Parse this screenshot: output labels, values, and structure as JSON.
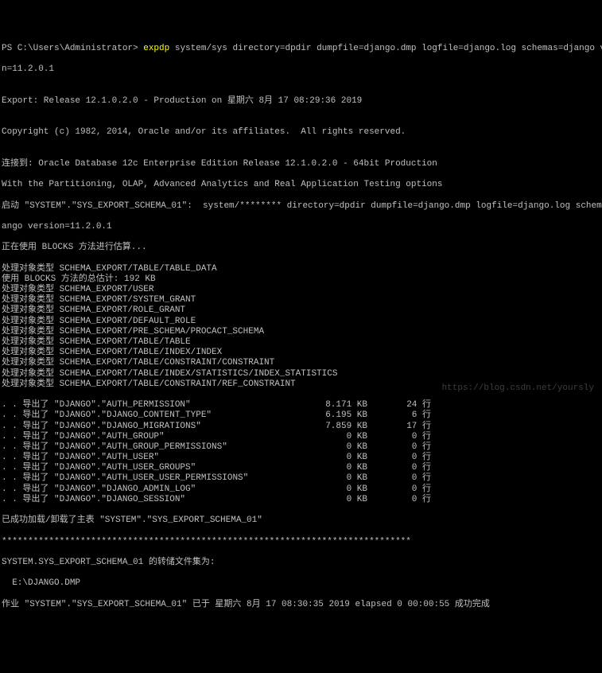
{
  "prompt": {
    "prefix": "PS C:\\Users\\Administrator> ",
    "command": "expdp",
    "args": " system/sys directory=dpdir dumpfile=django.dmp logfile=django.log schemas=django versio",
    "args_line2": "n=11.2.0.1"
  },
  "blank1": "",
  "export_line": "Export: Release 12.1.0.2.0 - Production on 星期六 8月 17 08:29:36 2019",
  "blank2": "",
  "copyright": "Copyright (c) 1982, 2014, Oracle and/or its affiliates.  All rights reserved.",
  "blank3": "",
  "connected": "连接到: Oracle Database 12c Enterprise Edition Release 12.1.0.2.0 - 64bit Production",
  "with_line": "With the Partitioning, OLAP, Advanced Analytics and Real Application Testing options",
  "start_line1": "启动 \"SYSTEM\".\"SYS_EXPORT_SCHEMA_01\":  system/******** directory=dpdir dumpfile=django.dmp logfile=django.log schemas=dj",
  "start_line2": "ango version=11.2.0.1",
  "using_blocks": "正在使用 BLOCKS 方法进行估算...",
  "types": [
    "处理对象类型 SCHEMA_EXPORT/TABLE/TABLE_DATA",
    "使用 BLOCKS 方法的总估计: 192 KB",
    "处理对象类型 SCHEMA_EXPORT/USER",
    "处理对象类型 SCHEMA_EXPORT/SYSTEM_GRANT",
    "处理对象类型 SCHEMA_EXPORT/ROLE_GRANT",
    "处理对象类型 SCHEMA_EXPORT/DEFAULT_ROLE",
    "处理对象类型 SCHEMA_EXPORT/PRE_SCHEMA/PROCACT_SCHEMA",
    "处理对象类型 SCHEMA_EXPORT/TABLE/TABLE",
    "处理对象类型 SCHEMA_EXPORT/TABLE/INDEX/INDEX",
    "处理对象类型 SCHEMA_EXPORT/TABLE/CONSTRAINT/CONSTRAINT",
    "处理对象类型 SCHEMA_EXPORT/TABLE/INDEX/STATISTICS/INDEX_STATISTICS",
    "处理对象类型 SCHEMA_EXPORT/TABLE/CONSTRAINT/REF_CONSTRAINT"
  ],
  "exports": [
    {
      "name": ". . 导出了 \"DJANGO\".\"AUTH_PERMISSION\"",
      "size": "8.171 KB",
      "rows": "24 行"
    },
    {
      "name": ". . 导出了 \"DJANGO\".\"DJANGO_CONTENT_TYPE\"",
      "size": "6.195 KB",
      "rows": "6 行"
    },
    {
      "name": ". . 导出了 \"DJANGO\".\"DJANGO_MIGRATIONS\"",
      "size": "7.859 KB",
      "rows": "17 行"
    },
    {
      "name": ". . 导出了 \"DJANGO\".\"AUTH_GROUP\"",
      "size": "0 KB",
      "rows": "0 行"
    },
    {
      "name": ". . 导出了 \"DJANGO\".\"AUTH_GROUP_PERMISSIONS\"",
      "size": "0 KB",
      "rows": "0 行"
    },
    {
      "name": ". . 导出了 \"DJANGO\".\"AUTH_USER\"",
      "size": "0 KB",
      "rows": "0 行"
    },
    {
      "name": ". . 导出了 \"DJANGO\".\"AUTH_USER_GROUPS\"",
      "size": "0 KB",
      "rows": "0 行"
    },
    {
      "name": ". . 导出了 \"DJANGO\".\"AUTH_USER_USER_PERMISSIONS\"",
      "size": "0 KB",
      "rows": "0 行"
    },
    {
      "name": ". . 导出了 \"DJANGO\".\"DJANGO_ADMIN_LOG\"",
      "size": "0 KB",
      "rows": "0 行"
    },
    {
      "name": ". . 导出了 \"DJANGO\".\"DJANGO_SESSION\"",
      "size": "0 KB",
      "rows": "0 行"
    }
  ],
  "loaded": "已成功加载/卸载了主表 \"SYSTEM\".\"SYS_EXPORT_SCHEMA_01\"",
  "separator": "******************************************************************************",
  "dump_set": "SYSTEM.SYS_EXPORT_SCHEMA_01 的转储文件集为:",
  "dump_file": "  E:\\DJANGO.DMP",
  "job_done": "作业 \"SYSTEM\".\"SYS_EXPORT_SCHEMA_01\" 已于 星期六 8月 17 08:30:35 2019 elapsed 0 00:00:55 成功完成",
  "watermark": "https://blog.csdn.net/yoursly"
}
